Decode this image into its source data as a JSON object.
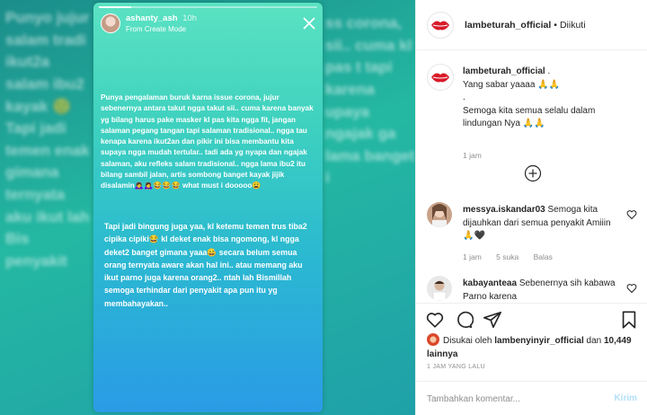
{
  "story": {
    "username": "ashanty_ash",
    "time": "10h",
    "subtitle": "From Create Mode",
    "progress": 0.15,
    "paragraph1": "Punya pengalaman buruk karna issue corona, jujur sebenernya antara takut ngga takut sii.. cuma karena banyak yg bilang harus pake masker kl pas kita ngga fit, jangan salaman pegang tangan tapi salaman tradisional.. ngga tau kenapa karena ikut2an dan pikir ini bisa membantu kita supaya ngga mudah tertular.. tadi ada yg nyapa dan ngajak salaman, aku refleks salam tradisional.. ngga lama ibu2 itu bilang sambil jalan, artis sombong banget kayak jijik disalamin🙇‍♀️🙇‍♀️😂😂😂 what must i dooooo😩",
    "paragraph2": "Tapi jadi bingung juga yaa, kl ketemu temen trus tiba2 cipika cipiki😂 kl deket enak bisa ngomong, kl ngga deket2 banget gimana yaaa😅 secara belum semua orang ternyata aware akan hal ini.. atau memang aku ikut parno juga karena orang2.. ntah lah Bismillah semoga terhindar dari penyakit apa pun itu yg membahayakan..",
    "blur_left": "Punyo jujur salam tradi ikut2a salam ibu2 kayak 🙂 Tapi jadi temen enak gimana ternyata aku ikut lah Bis penyakit",
    "blur_right": "ss corona, sii.. cuma kl pas t tapi karena upaya ngajak ga lama banget i"
  },
  "post": {
    "account": "lambeturah_official",
    "separator": "•",
    "follow_status": "Diikuti",
    "caption_user": "lambeturah_official",
    "caption_line1": ".",
    "caption_line2": "Yang sabar yaaaa 🙏🙏",
    "caption_line3": ".",
    "caption_line4": "Semoga kita semua selalu dalam lindungan Nya 🙏🙏",
    "caption_time": "1 jam",
    "comments": [
      {
        "user": "messya.iskandar03",
        "text": "Semoga kita dijauhkan dari semua penyakit Amiiin 🙏🖤",
        "time": "1 jam",
        "likes": "5 suka",
        "reply": "Balas"
      },
      {
        "user": "kabayanteaa",
        "text": "Sebenernya sih kabawa Parno karena"
      }
    ],
    "liked_by_prefix": "Disukai oleh",
    "liked_by_user": "lambenyinyir_official",
    "liked_by_and": "dan",
    "liked_by_count": "10,449 lainnya",
    "time_ago": "1 JAM YANG LALU",
    "comment_placeholder": "Tambahkan komentar...",
    "post_button": "Kirim"
  },
  "colors": {
    "story_top": "#5be2c2",
    "story_bottom": "#2a9be6",
    "link_disabled": "#b2dffc",
    "muted": "#8e8e8e"
  }
}
